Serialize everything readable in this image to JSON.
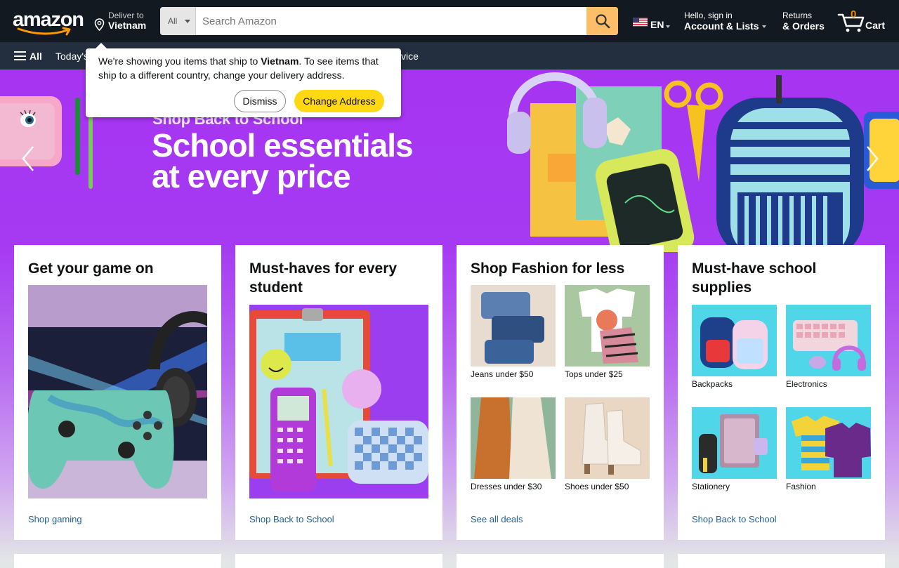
{
  "header": {
    "logo_text": "amazon",
    "deliver_label": "Deliver to",
    "deliver_location": "Vietnam",
    "search_category": "All",
    "search_placeholder": "Search Amazon",
    "language": "EN",
    "account_greeting": "Hello, sign in",
    "account_label": "Account & Lists",
    "returns_label": "Returns",
    "orders_label": "& Orders",
    "cart_count": "0",
    "cart_label": "Cart"
  },
  "subnav": {
    "all_label": "All",
    "items": [
      "Today's",
      "vice"
    ]
  },
  "popover": {
    "message_before": "We're showing you items that ship to ",
    "country": "Vietnam",
    "message_after": ". To see items that ship to a different country, change your delivery address.",
    "dismiss_label": "Dismiss",
    "change_label": "Change Address"
  },
  "hero": {
    "kicker": "Shop Back to School",
    "headline": "School essentials at every price"
  },
  "cards": [
    {
      "title": "Get your game on",
      "link": "Shop gaming"
    },
    {
      "title": "Must-haves for every student",
      "link": "Shop Back to School"
    },
    {
      "title": "Shop Fashion for less",
      "link": "See all deals",
      "tiles": [
        "Jeans under $50",
        "Tops under $25",
        "Dresses under $30",
        "Shoes under $50"
      ]
    },
    {
      "title": "Must-have school supplies",
      "link": "Shop Back to School",
      "tiles": [
        "Backpacks",
        "Electronics",
        "Stationery",
        "Fashion"
      ]
    }
  ],
  "colors": {
    "nav_dark": "#131921",
    "nav_sub": "#232f3e",
    "search_button": "#febd69",
    "hero_purple": "#a634f1",
    "cart_count": "#f08804",
    "link_blue": "#2162a1",
    "primary_button": "#ffd814"
  }
}
